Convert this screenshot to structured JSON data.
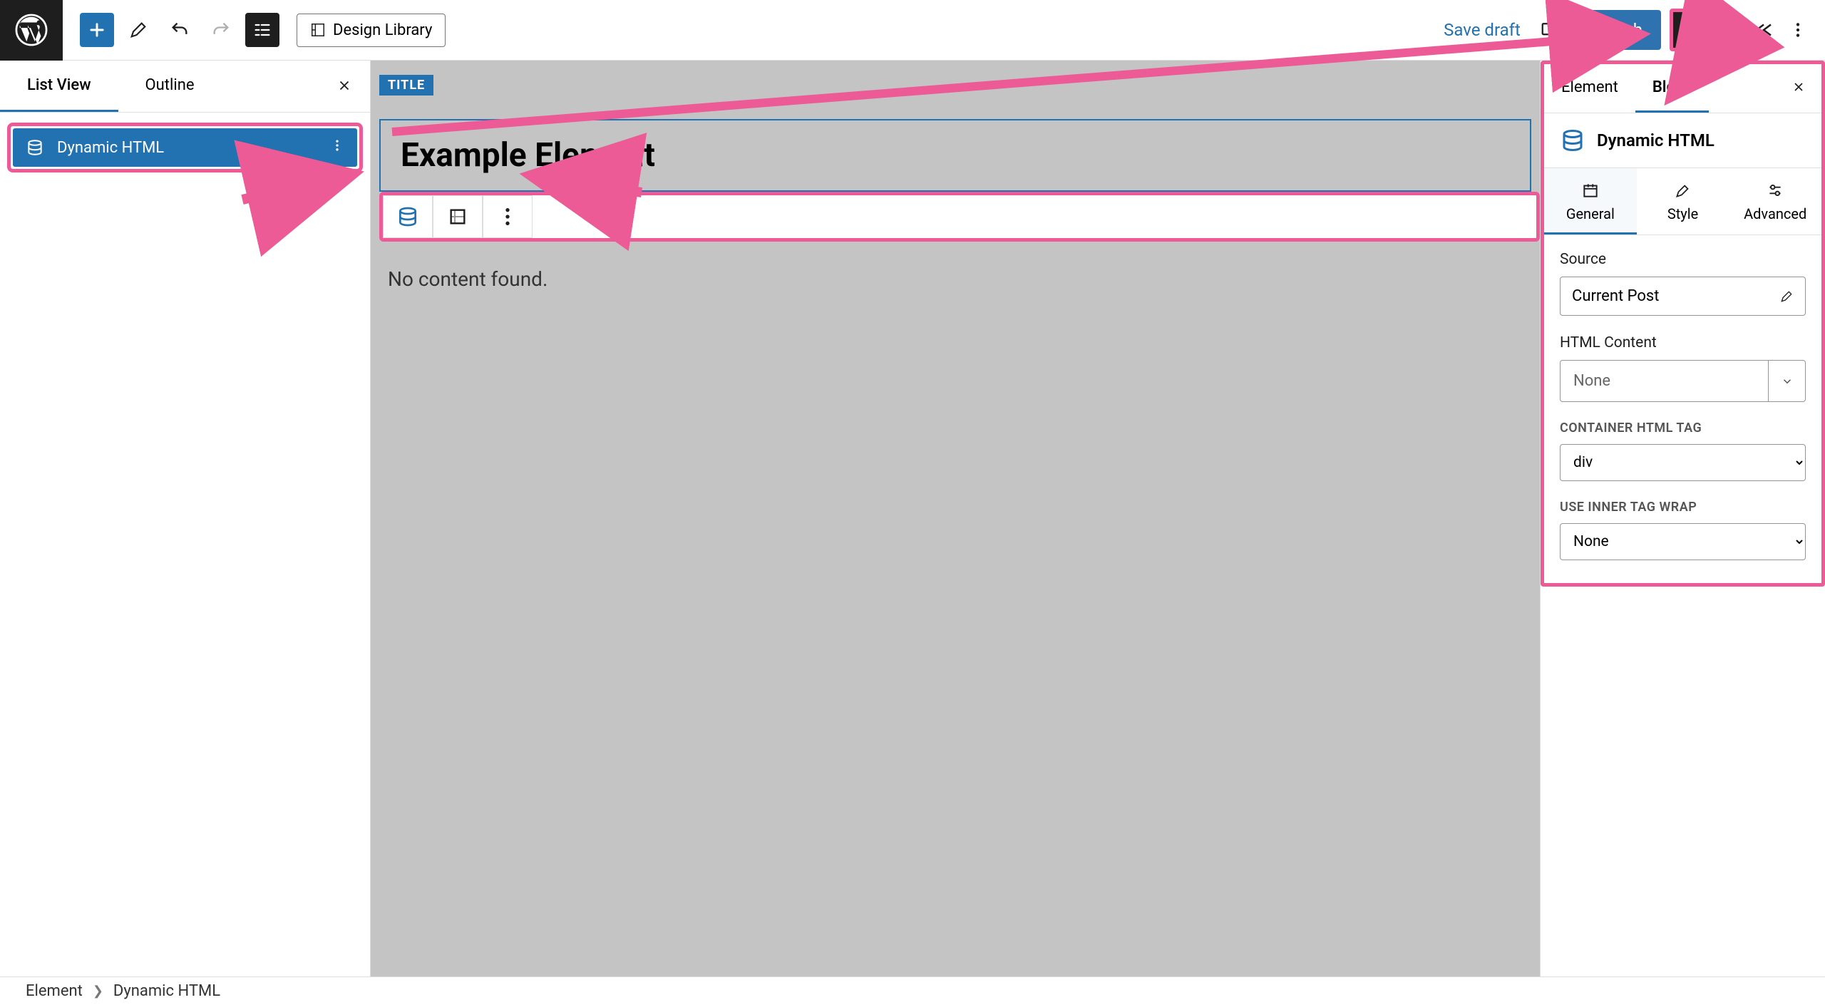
{
  "topbar": {
    "design_library": "Design Library",
    "save_draft": "Save draft",
    "publish": "Publish"
  },
  "left_panel": {
    "tabs": {
      "list_view": "List View",
      "outline": "Outline"
    },
    "block_item": "Dynamic HTML"
  },
  "canvas": {
    "title_tag": "TITLE",
    "block_title": "Example Element",
    "no_content": "No content found."
  },
  "right_panel": {
    "tabs": {
      "element": "Element",
      "block": "Block"
    },
    "block_name": "Dynamic HTML",
    "subtabs": {
      "general": "General",
      "style": "Style",
      "advanced": "Advanced"
    },
    "source_label": "Source",
    "source_value": "Current Post",
    "html_content_label": "HTML Content",
    "html_content_value": "None",
    "container_tag_label": "Container HTML Tag",
    "container_tag_value": "div",
    "inner_wrap_label": "Use Inner Tag Wrap",
    "inner_wrap_value": "None"
  },
  "footer": {
    "crumb1": "Element",
    "crumb2": "Dynamic HTML"
  }
}
